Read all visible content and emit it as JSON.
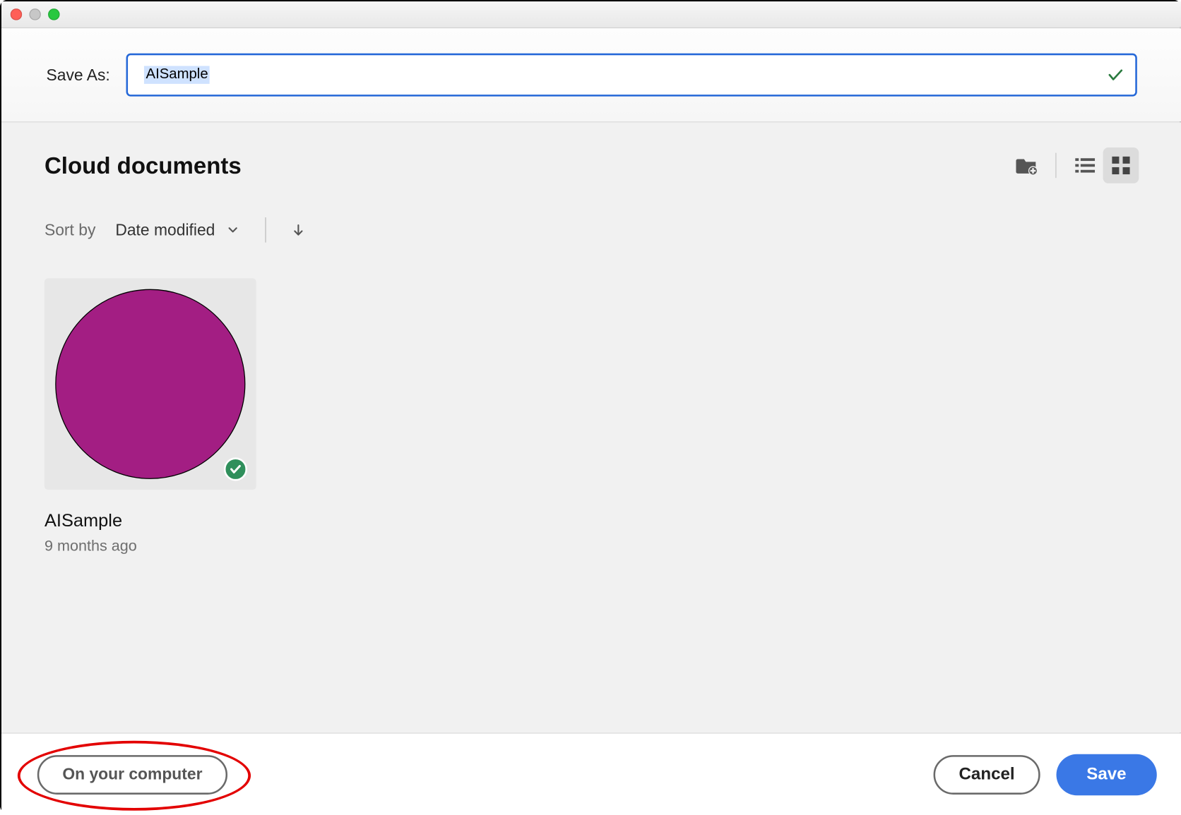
{
  "saveas": {
    "label": "Save As:",
    "value": "AISample"
  },
  "section": {
    "title": "Cloud documents"
  },
  "sort": {
    "label": "Sort by",
    "selected": "Date modified"
  },
  "documents": [
    {
      "name": "AISample",
      "meta": "9 months ago",
      "thumb_color": "#a31e83",
      "synced": true
    }
  ],
  "footer": {
    "on_computer": "On your computer",
    "cancel": "Cancel",
    "save": "Save"
  }
}
